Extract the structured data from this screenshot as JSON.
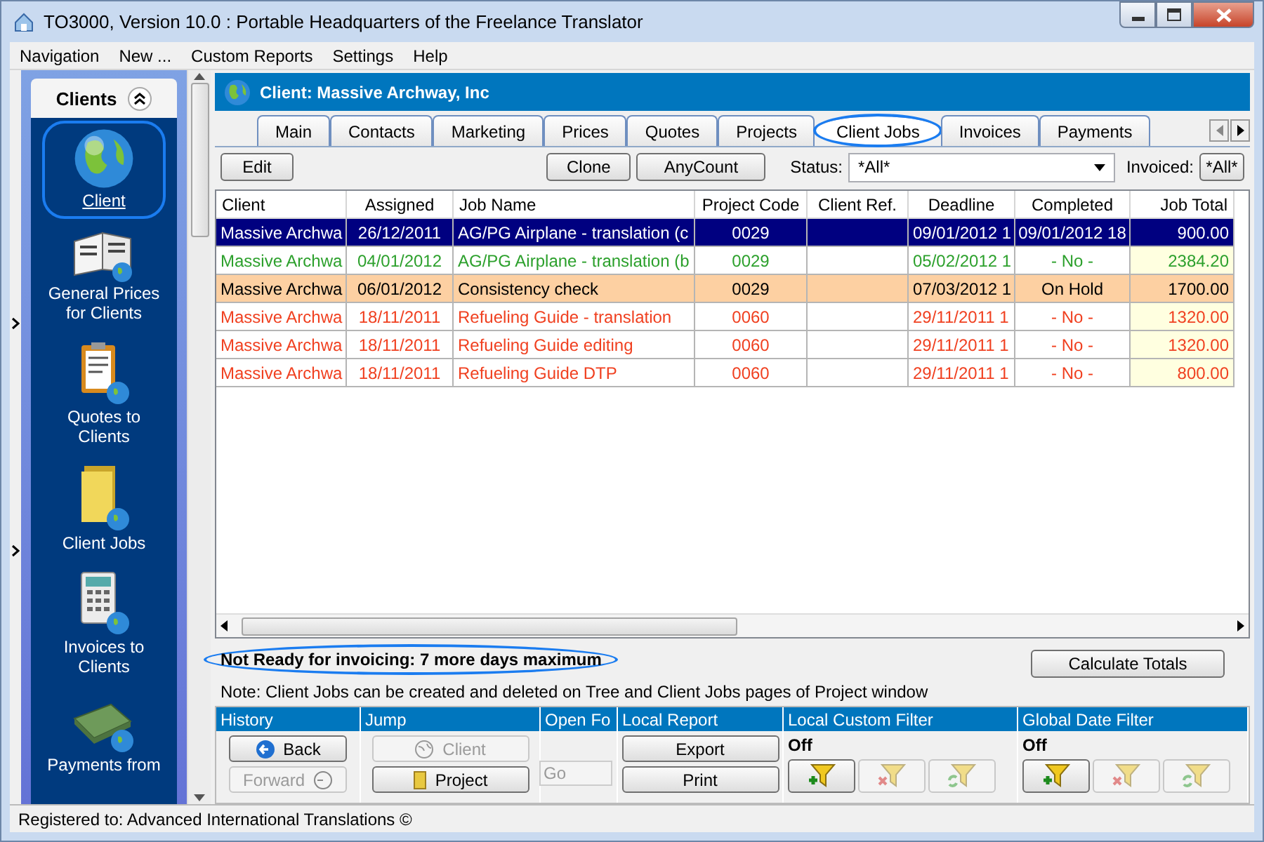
{
  "window": {
    "title": "TO3000, Version 10.0 : Portable Headquarters of the Freelance Translator"
  },
  "menu": [
    "Navigation",
    "New ...",
    "Custom Reports",
    "Settings",
    "Help"
  ],
  "sidebar": {
    "title": "Clients",
    "items": [
      {
        "label": "Client",
        "selected": true
      },
      {
        "label": "General Prices for Clients",
        "selected": false
      },
      {
        "label": "Quotes to Clients",
        "selected": false
      },
      {
        "label": "Client Jobs",
        "selected": false
      },
      {
        "label": "Invoices to Clients",
        "selected": false
      },
      {
        "label": "Payments from",
        "selected": false
      }
    ]
  },
  "header": {
    "title": "Client: Massive Archway, Inc"
  },
  "tabs": [
    {
      "label": "Main",
      "selected": false
    },
    {
      "label": "Contacts",
      "selected": false
    },
    {
      "label": "Marketing",
      "selected": false
    },
    {
      "label": "Prices",
      "selected": false
    },
    {
      "label": "Quotes",
      "selected": false
    },
    {
      "label": "Projects",
      "selected": false
    },
    {
      "label": "Client Jobs",
      "selected": true
    },
    {
      "label": "Invoices",
      "selected": false
    },
    {
      "label": "Payments",
      "selected": false
    }
  ],
  "toolbar": {
    "buttons": [
      "Edit",
      "Clone",
      "AnyCount"
    ],
    "status_label": "Status:",
    "status_value": "*All*",
    "invoiced_label": "Invoiced:",
    "invoiced_value": "*All*"
  },
  "table": {
    "columns": [
      "Client",
      "Assigned",
      "Job Name",
      "Project Code",
      "Client Ref.",
      "Deadline",
      "Completed",
      "Job Total"
    ],
    "rows": [
      {
        "selected": true,
        "on_hold": false,
        "cells": [
          "Massive Archwa",
          "26/12/2011",
          "AG/PG Airplane - translation (c",
          "0029",
          "",
          "09/01/2012 1",
          "09/01/2012 18",
          "900.00"
        ]
      },
      {
        "selected": false,
        "on_hold": false,
        "color": "#2ca02c",
        "cells": [
          "Massive Archwa",
          "04/01/2012",
          "AG/PG Airplane - translation (b",
          "0029",
          "",
          "05/02/2012 1",
          "- No -",
          "2384.20"
        ]
      },
      {
        "selected": false,
        "on_hold": true,
        "cells": [
          "Massive Archwa",
          "06/01/2012",
          "Consistency check",
          "0029",
          "",
          "07/03/2012 1",
          "On Hold",
          "1700.00"
        ]
      },
      {
        "selected": false,
        "on_hold": false,
        "color": "#f04020",
        "cells": [
          "Massive Archwa",
          "18/11/2011",
          "Refueling Guide - translation",
          "0060",
          "",
          "29/11/2011 1",
          "- No -",
          "1320.00"
        ]
      },
      {
        "selected": false,
        "on_hold": false,
        "color": "#f04020",
        "cells": [
          "Massive Archwa",
          "18/11/2011",
          "Refueling Guide editing",
          "0060",
          "",
          "29/11/2011 1",
          "- No -",
          "1320.00"
        ]
      },
      {
        "selected": false,
        "on_hold": false,
        "color": "#f04020",
        "cells": [
          "Massive Archwa",
          "18/11/2011",
          "Refueling Guide DTP",
          "0060",
          "",
          "29/11/2011 1",
          "- No -",
          "800.00"
        ]
      }
    ]
  },
  "notice": {
    "text": "Not Ready for invoicing: 7 more days maximum",
    "circled": true
  },
  "calculate_button": "Calculate Totals",
  "note": "Note: Client Jobs can be created and deleted on Tree and Client Jobs pages of Project window",
  "groups": [
    {
      "title": "History",
      "kind": "buttons",
      "buttons": [
        {
          "label": "Back",
          "disabled": false
        },
        {
          "label": "Forward",
          "disabled": true
        }
      ]
    },
    {
      "title": "Jump",
      "kind": "buttons",
      "buttons": [
        {
          "label": "Client",
          "disabled": true
        },
        {
          "label": "Project",
          "disabled": false
        }
      ]
    },
    {
      "title": "Open Fo",
      "kind": "field",
      "field": {
        "label": "Go",
        "disabled": true
      }
    },
    {
      "title": "Local Report",
      "kind": "buttons",
      "buttons": [
        {
          "label": "Export",
          "disabled": false
        },
        {
          "label": "Print",
          "disabled": false
        }
      ]
    },
    {
      "title": "Local Custom Filter",
      "kind": "filter",
      "state": "Off",
      "filters": [
        {
          "disabled": false
        },
        {
          "disabled": true
        },
        {
          "disabled": true
        }
      ]
    },
    {
      "title": "Global Date Filter",
      "kind": "filter",
      "state": "Off",
      "filters": [
        {
          "disabled": false
        },
        {
          "disabled": true
        },
        {
          "disabled": true
        }
      ]
    }
  ],
  "status_bar": "Registered to: Advanced International Translations ©"
}
